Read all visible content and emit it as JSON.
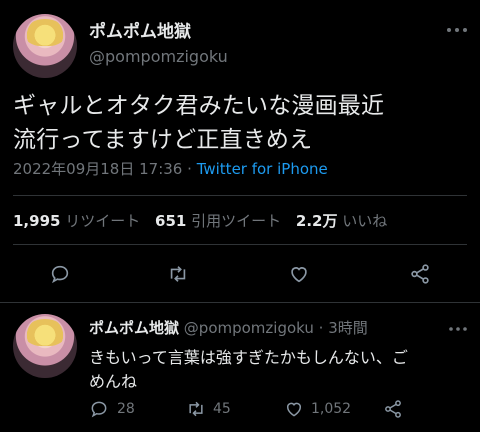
{
  "tweet": {
    "display_name": "ポムポム地獄",
    "handle": "@pompomzigoku",
    "text_line1": "ギャルとオタク君みたいな漫画最近",
    "text_line2": "流行ってますけど正直きめえ",
    "timestamp": "2022年09月18日 17:36",
    "separator": "·",
    "source": "Twitter for iPhone",
    "stats": {
      "retweets_count": "1,995",
      "retweets_label": "リツイート",
      "quotes_count": "651",
      "quotes_label": "引用ツイート",
      "likes_count": "2.2万",
      "likes_label": "いいね"
    }
  },
  "reply": {
    "display_name": "ポムポム地獄",
    "handle": "@pompomzigoku",
    "separator": "·",
    "time": "3時間",
    "text_line1": "きもいって言葉は強すぎたかもしんない、ご",
    "text_line2": "めんね",
    "replies": "28",
    "retweets": "45",
    "likes": "1,052"
  },
  "colors": {
    "background": "#000000",
    "text": "#e7e9ea",
    "muted": "#71767b",
    "link": "#1d9bf0",
    "divider": "#2f3336"
  }
}
